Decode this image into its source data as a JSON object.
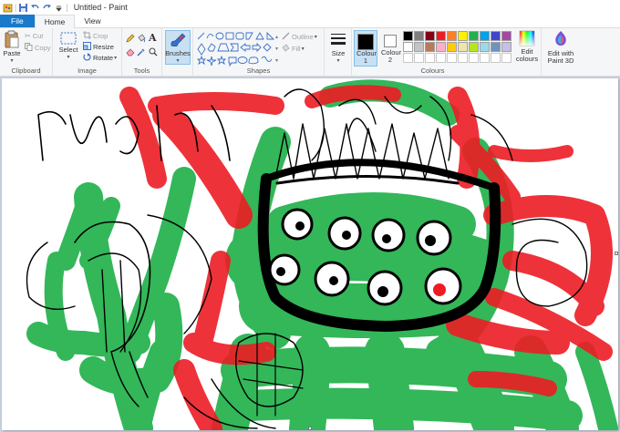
{
  "window": {
    "title": "Untitled - Paint"
  },
  "tabs": [
    {
      "label": "File"
    },
    {
      "label": "Home"
    },
    {
      "label": "View"
    }
  ],
  "ribbon": {
    "clipboard": {
      "label": "Clipboard",
      "paste": "Paste",
      "cut": "Cut",
      "copy": "Copy"
    },
    "image": {
      "label": "Image",
      "select": "Select",
      "crop": "Crop",
      "resize": "Resize",
      "rotate": "Rotate"
    },
    "tools": {
      "label": "Tools"
    },
    "brushes": {
      "label": "Brushes"
    },
    "shapes": {
      "label": "Shapes",
      "outline": "Outline",
      "fill": "Fill"
    },
    "size": {
      "label": "Size"
    },
    "colours": {
      "label": "Colours",
      "colour1": "Colour 1",
      "colour2": "Colour 2",
      "colour1_value": "#000000",
      "colour2_value": "#ffffff",
      "palette_row1": [
        "#000000",
        "#7f7f7f",
        "#880015",
        "#ed1c24",
        "#ff7f27",
        "#fff200",
        "#22b14c",
        "#00a2e8",
        "#3f48cc",
        "#a349a4"
      ],
      "palette_row2": [
        "#ffffff",
        "#c3c3c3",
        "#b97a57",
        "#ffaec9",
        "#ffc90e",
        "#efe4b0",
        "#b5e61d",
        "#99d9ea",
        "#7092be",
        "#c8bfe7"
      ],
      "edit_colours": "Edit colours",
      "edit_paint3d": "Edit with Paint 3D"
    }
  },
  "canvas": {
    "background": "#ffffff",
    "colors": {
      "green": "#22b14c",
      "red": "#ed1c24",
      "black": "#000000"
    }
  }
}
